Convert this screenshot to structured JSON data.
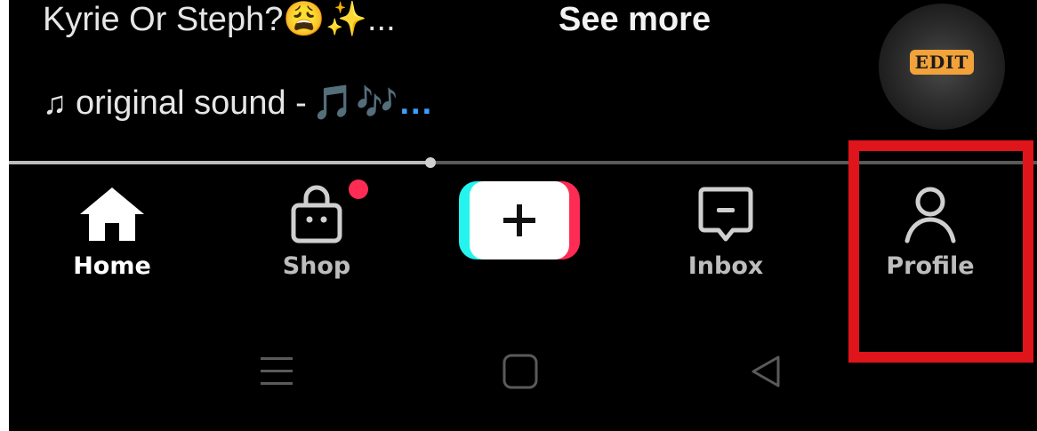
{
  "video": {
    "caption": "Kyrie Or Steph?😩✨...",
    "see_more": "See more",
    "sound_prefix": "♫",
    "sound_text": "original sound -",
    "sound_emoji": "🎵🎶...",
    "disc_label": "EDIT"
  },
  "progress": {
    "fraction": 0.41
  },
  "bottom_nav": {
    "home_label": "Home",
    "shop_label": "Shop",
    "inbox_label": "Inbox",
    "profile_label": "Profile",
    "shop_has_badge": true
  },
  "colors": {
    "background": "#000000",
    "active_label": "#ffffff",
    "muted_label": "#bdbdbd",
    "badge": "#fe2c55",
    "create_cyan": "#25f4ee",
    "create_red": "#fe2c55",
    "highlight": "#e0141b"
  },
  "icons": {
    "home": "home-icon",
    "shop": "shopping-bag-icon",
    "create": "plus-icon",
    "inbox": "message-icon",
    "profile": "person-icon",
    "system_menu": "menu-lines-icon",
    "system_home": "square-icon",
    "system_back": "back-triangle-icon"
  }
}
